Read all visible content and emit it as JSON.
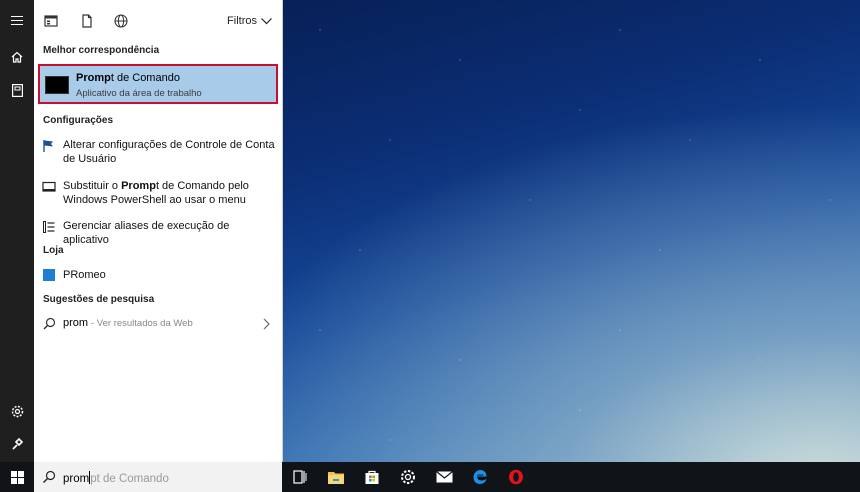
{
  "panel": {
    "filters_label": "Filtros",
    "best_match": {
      "header": "Melhor correspondência",
      "title_bold": "Promp",
      "title_rest": "t de Comando",
      "subtitle": "Aplicativo da área de trabalho"
    },
    "settings": {
      "header": "Configurações",
      "items": [
        {
          "label": "Alterar configurações de Controle de Conta de Usuário"
        },
        {
          "label_pre": "Substituir o ",
          "label_bold": "Promp",
          "label_post": "t de Comando pelo Windows PowerShell ao usar o menu"
        },
        {
          "label": "Gerenciar aliases de execução de aplicativo"
        }
      ]
    },
    "store": {
      "header": "Loja",
      "items": [
        {
          "label": "PRomeo"
        }
      ]
    },
    "web": {
      "header": "Sugestões de pesquisa",
      "query": "prom",
      "hint": "- Ver resultados da Web"
    }
  },
  "search": {
    "typed": "prom",
    "ghost": "pt de Comando"
  },
  "colors": {
    "highlight": "#a9cbea",
    "highlight_border": "#c8102e",
    "rail": "#1f1f1f",
    "taskbar": "#101418"
  },
  "icons": {
    "rail": [
      "hamburger-icon",
      "home-icon",
      "notebook-icon",
      "settings-gear-icon",
      "user-feedback-icon"
    ],
    "taskbar": [
      "windows-logo-icon",
      "search-icon",
      "task-view-icon",
      "file-explorer-icon",
      "store-icon",
      "settings-icon",
      "mail-icon",
      "edge-icon",
      "opera-icon"
    ]
  }
}
